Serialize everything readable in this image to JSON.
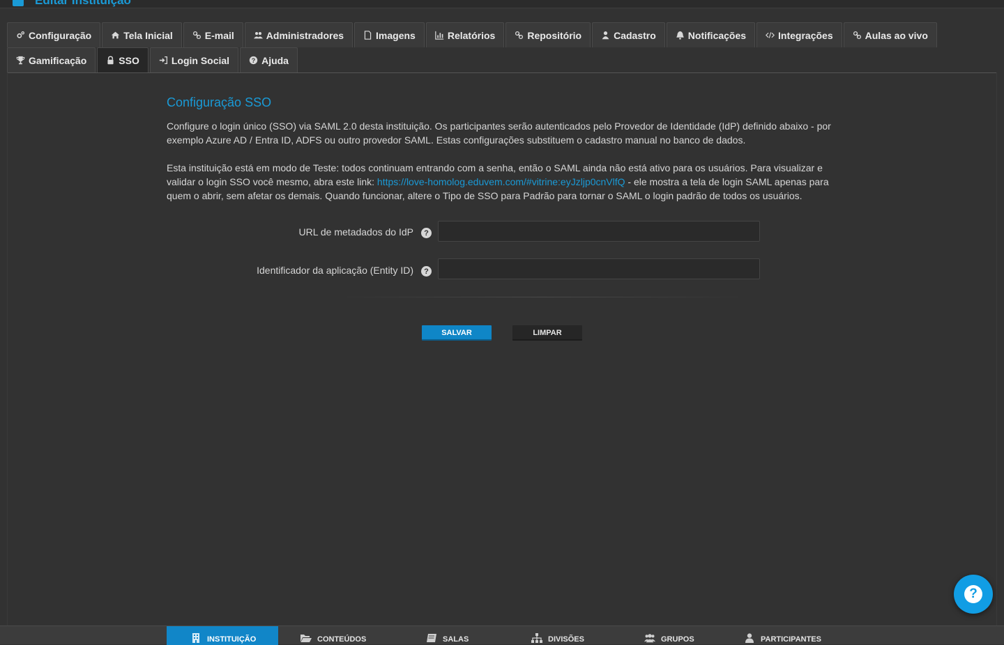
{
  "header": {
    "title": "Editar Instituição"
  },
  "tabs": {
    "row1": [
      {
        "label": "Configuração",
        "icon": "cogs-icon"
      },
      {
        "label": "Tela Inicial",
        "icon": "home-icon"
      },
      {
        "label": "E-mail",
        "icon": "link-icon"
      },
      {
        "label": "Administradores",
        "icon": "users-icon"
      },
      {
        "label": "Imagens",
        "icon": "file-icon"
      },
      {
        "label": "Relatórios",
        "icon": "bar-chart-icon"
      },
      {
        "label": "Repositório",
        "icon": "link-icon"
      },
      {
        "label": "Cadastro",
        "icon": "user-icon"
      },
      {
        "label": "Notificações",
        "icon": "bell-icon"
      },
      {
        "label": "Integrações",
        "icon": "code-icon"
      },
      {
        "label": "Aulas ao vivo",
        "icon": "link-icon"
      }
    ],
    "row2": [
      {
        "label": "Gamificação",
        "icon": "trophy-icon"
      },
      {
        "label": "SSO",
        "icon": "lock-icon",
        "active": true
      },
      {
        "label": "Login Social",
        "icon": "sign-in-icon"
      },
      {
        "label": "Ajuda",
        "icon": "question-circle-icon"
      }
    ]
  },
  "sso": {
    "title": "Configuração SSO",
    "intro": "Configure o login único (SSO) via SAML 2.0 desta instituição. Os participantes serão autenticados pelo Provedor de Identidade (IdP) definido abaixo - por exemplo Azure AD / Entra ID, ADFS ou outro provedor SAML. Estas configurações substituem o cadastro manual no banco de dados.",
    "test_mode_before": "Esta instituição está em modo de Teste: todos continuam entrando com a senha, então o SAML ainda não está ativo para os usuários. Para visualizar e validar o login SSO você mesmo, abra este link: ",
    "test_link": "https://love-homolog.eduvem.com/#vitrine:eyJzljp0cnVlfQ",
    "test_mode_after": " - ele mostra a tela de login SAML apenas para quem o abrir, sem afetar os demais. Quando funcionar, altere o Tipo de SSO para Padrão para tornar o SAML o login padrão de todos os usuários.",
    "fields": {
      "metadata_url": {
        "label": "URL de metadados do IdP",
        "value": "",
        "help": "?"
      },
      "entity_id": {
        "label": "Identificador da aplicação (Entity ID)",
        "value": "",
        "help": "?"
      }
    },
    "save_label": "SALVAR",
    "clear_label": "LIMPAR"
  },
  "fab": {
    "glyph": "?"
  },
  "bottom_nav": [
    {
      "label": "INSTITUIÇÃO",
      "icon": "building-icon",
      "active": true
    },
    {
      "label": "CONTEÚDOS",
      "icon": "folder-open-icon"
    },
    {
      "label": "SALAS",
      "icon": "book-icon"
    },
    {
      "label": "DIVISÕES",
      "icon": "sitemap-icon"
    },
    {
      "label": "GRUPOS",
      "icon": "group-icon"
    },
    {
      "label": "PARTICIPANTES",
      "icon": "person-icon"
    }
  ],
  "colors": {
    "accent": "#1a9ad6",
    "background": "#323232",
    "save_button": "#0f86c7",
    "fab": "#119de4"
  }
}
